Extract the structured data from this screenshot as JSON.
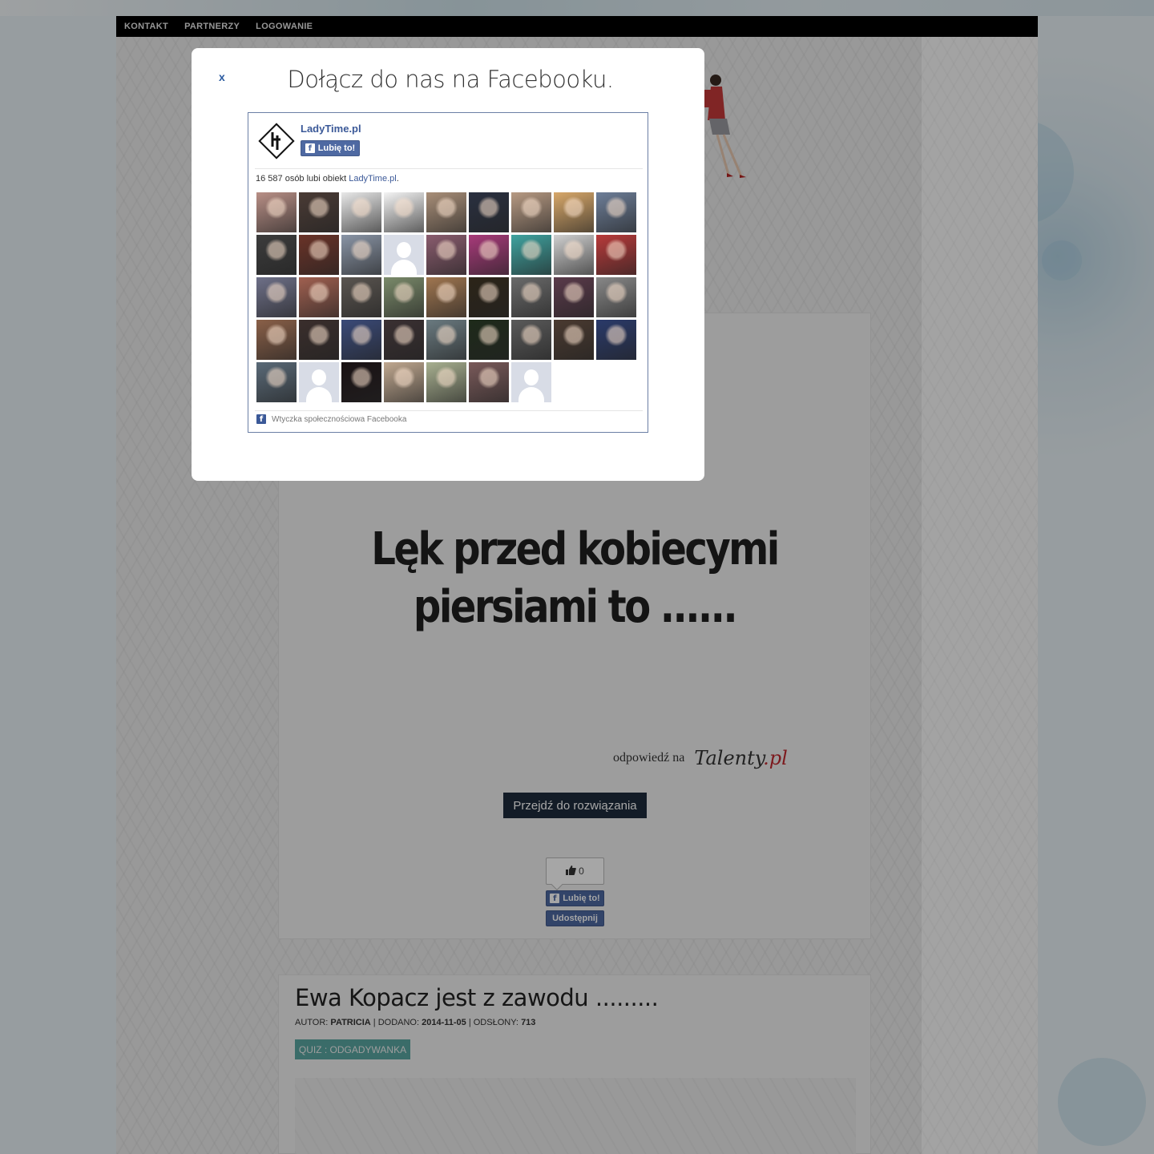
{
  "nav": {
    "items": [
      "KONTAKT",
      "PARTNERZY",
      "LOGOWANIE"
    ]
  },
  "modal": {
    "close_label": "x",
    "title": "Dołącz do nas na Facebooku.",
    "page_name": "LadyTime.pl",
    "like_label": "Lubię to!",
    "count_text": "16 587 osób lubi obiekt ",
    "count_link": "LadyTime.pl",
    "count_suffix": ".",
    "footer_text": "Wtyczka społecznościowa Facebooka",
    "faces": [
      "#b88f86",
      "#4a3b35",
      "#e8e8e8",
      "#f4f4f4",
      "#a88e78",
      "#2a3040",
      "#b79a83",
      "#d8a86a",
      "#6d7e98",
      "#3c3c3c",
      "#6a3328",
      "#8a95a6",
      "blank",
      "#8a5c6e",
      "#a83a7a",
      "#3fa3a0",
      "#cfcfcf",
      "#b83a3a",
      "#6e7088",
      "#a06050",
      "#5a5550",
      "#7a8a6a",
      "#a07650",
      "#2c2418",
      "#6a6a6a",
      "#5a3a4a",
      "#888888",
      "#8a6048",
      "#3a2e2c",
      "#3a4a78",
      "#3a3032",
      "#6a7a80",
      "#1e2a1a",
      "#5a5a5a",
      "#4a3a30",
      "#2a3a6a",
      "#5a6a78",
      "blank",
      "#1a1214",
      "#c0a890",
      "#a8b090",
      "#7a5a5a",
      "blank"
    ]
  },
  "article1": {
    "headline": "Lęk przed kobiecymi piersiami to ......",
    "answer_prefix": "odpowiedź na",
    "answer_brand_main": "Talenty",
    "answer_brand_tld": ".pl",
    "solve_button": "Przejdź do rozwiązania",
    "like_count": "0",
    "fb_like_label": "Lubię to!",
    "fb_share_label": "Udostępnij"
  },
  "article2": {
    "title": "Ewa Kopacz jest z zawodu .........",
    "meta_author_label": "AUTOR: ",
    "meta_author": "PATRICIA",
    "meta_added_label": " | DODANO: ",
    "meta_added": "2014-11-05",
    "meta_views_label": " | ODSŁONY: ",
    "meta_views": "713",
    "tag": "QUIZ : ODGADYWANKA"
  }
}
